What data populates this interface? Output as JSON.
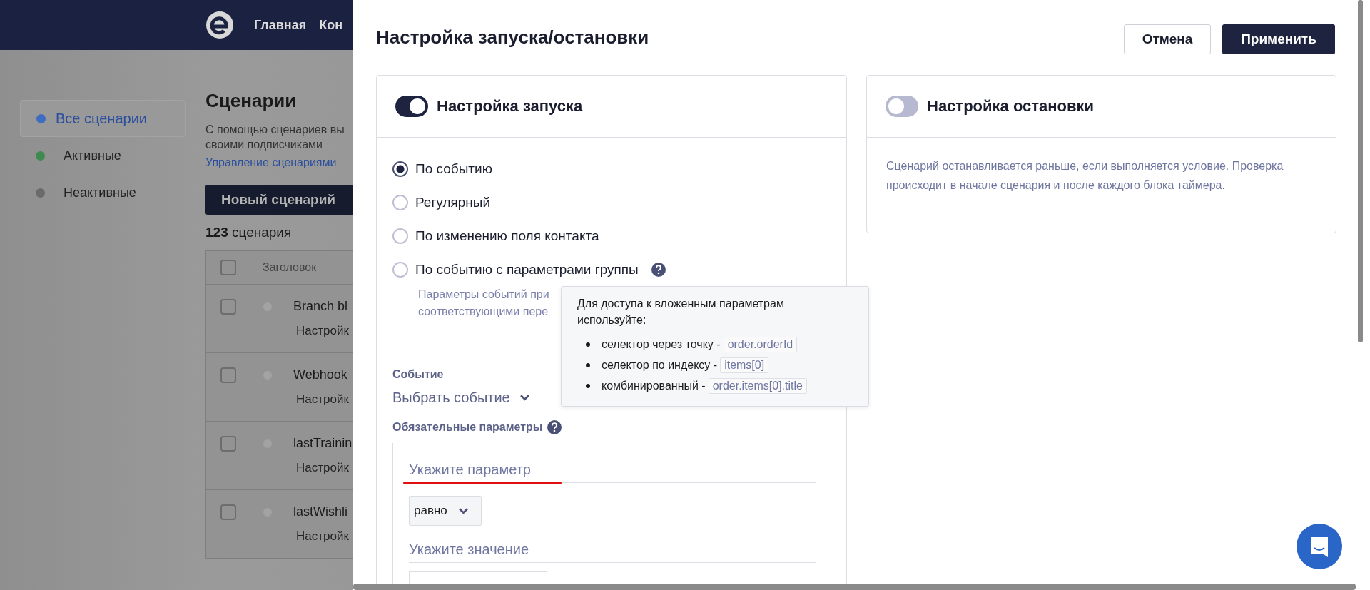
{
  "header": {
    "nav": [
      "Главная",
      "Кон"
    ]
  },
  "sidebar": {
    "items": [
      {
        "label": "Все сценарии",
        "color": "#3d6cc0",
        "selected": true
      },
      {
        "label": "Активные",
        "color": "#3e8a4f",
        "selected": false
      },
      {
        "label": "Неактивные",
        "color": "#6b6b6b",
        "selected": false
      }
    ]
  },
  "page": {
    "title": "Сценарии",
    "description": [
      "С помощью сценариев вы",
      "своими подписчиками"
    ],
    "link": "Управление сценариями",
    "new_button": "Новый сценарий",
    "count": "**123** сценария",
    "table": {
      "header": "Заголовок",
      "header_checked": false,
      "rows": [
        {
          "title": "Branch bl",
          "subtitle": "Настройк",
          "checked": false
        },
        {
          "title": "Webhook",
          "subtitle": "Настройк",
          "checked": false
        },
        {
          "title": "lastTrainin",
          "subtitle": "Настройк",
          "checked": false
        },
        {
          "title": "lastWishli",
          "subtitle": "Настройк",
          "checked": false
        }
      ]
    }
  },
  "modal": {
    "title": "Настройка запуска/остановки",
    "cancel": "Отмена",
    "apply": "Применить",
    "start": {
      "title": "Настройка запуска",
      "on": true,
      "options": [
        {
          "label": "По событию",
          "selected": true,
          "help": false
        },
        {
          "label": "Регулярный",
          "selected": false,
          "help": false
        },
        {
          "label": "По изменению поля контакта",
          "selected": false,
          "help": false
        },
        {
          "label": "По событию с параметрами группы",
          "selected": false,
          "help": true
        }
      ],
      "hint": [
        "Параметры событий при",
        "соответствующими пере"
      ],
      "event_label": "Событие",
      "event_select": "Выбрать событие",
      "required_label": "Обязательные параметры",
      "param_placeholder": "Укажите параметр",
      "param_error": true,
      "operator": "равно",
      "value_placeholder": "Укажите значение"
    },
    "stop": {
      "title": "Настройка остановки",
      "on": false,
      "description": "Сценарий останавливается раньше, если выполняется условие. Проверка происходит в начале сценария и после каждого блока таймера."
    },
    "tooltip": {
      "title": "Для доступа к вложенным параметрам используйте:",
      "items": [
        {
          "text": "селектор через точку -",
          "code": "order.orderId"
        },
        {
          "text": "селектор по индексу -",
          "code": "items[0]"
        },
        {
          "text": "комбинированный -",
          "code": "order.items[0].title"
        }
      ]
    }
  }
}
